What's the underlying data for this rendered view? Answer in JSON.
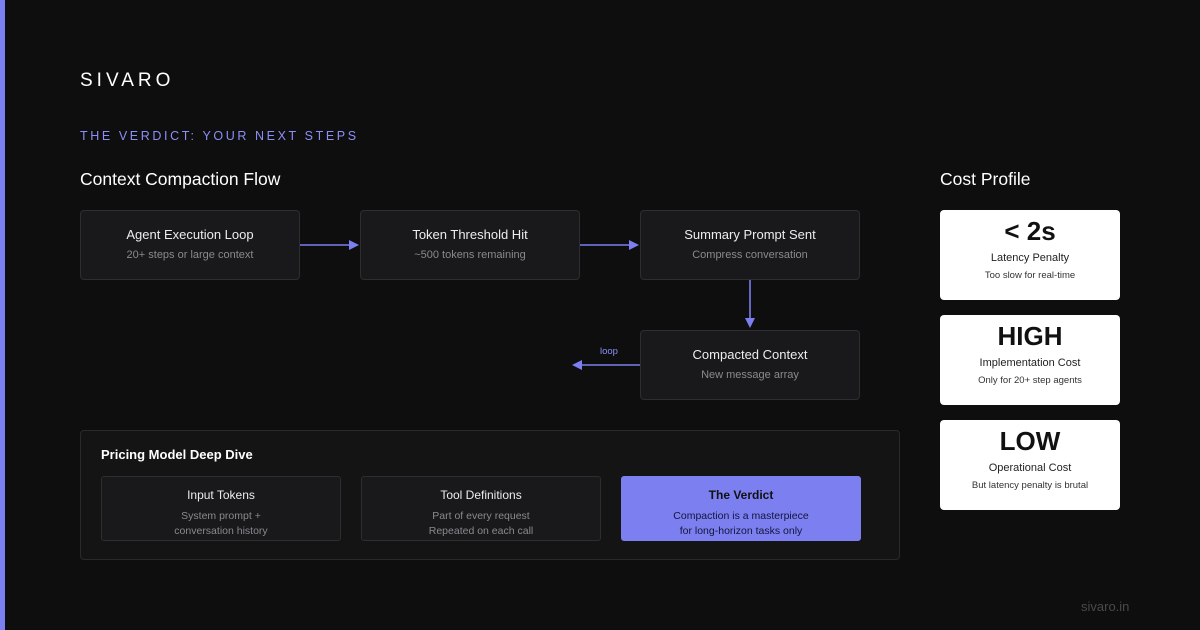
{
  "brand": "SIVARO",
  "eyebrow": "THE VERDICT: YOUR NEXT STEPS",
  "flow": {
    "title": "Context Compaction Flow",
    "nodes": [
      {
        "title": "Agent Execution Loop",
        "subtitle": "20+ steps or large context"
      },
      {
        "title": "Token Threshold Hit",
        "subtitle": "~500 tokens remaining"
      },
      {
        "title": "Summary Prompt Sent",
        "subtitle": "Compress conversation"
      },
      {
        "title": "Compacted Context",
        "subtitle": "New message array"
      }
    ],
    "loop_label": "loop",
    "accent_color": "#7b7ff0"
  },
  "pricing": {
    "title": "Pricing Model Deep Dive",
    "cards": [
      {
        "title": "Input Tokens",
        "line1": "System prompt +",
        "line2": "conversation history"
      },
      {
        "title": "Tool Definitions",
        "line1": "Part of every request",
        "line2": "Repeated on each call"
      },
      {
        "title": "The Verdict",
        "line1": "Compaction is a masterpiece",
        "line2": "for long-horizon tasks only",
        "highlight": true
      }
    ]
  },
  "cost_profile": {
    "title": "Cost Profile",
    "cards": [
      {
        "value": "< 2s",
        "label": "Latency Penalty",
        "sub": "Too slow for real-time"
      },
      {
        "value": "HIGH",
        "label": "Implementation Cost",
        "sub": "Only for 20+ step agents"
      },
      {
        "value": "LOW",
        "label": "Operational Cost",
        "sub": "But latency penalty is brutal"
      }
    ]
  },
  "footer": "sivaro.in",
  "colors": {
    "background": "#0e0e0f",
    "accent": "#7b7ff0",
    "card_light": "#ffffff"
  }
}
